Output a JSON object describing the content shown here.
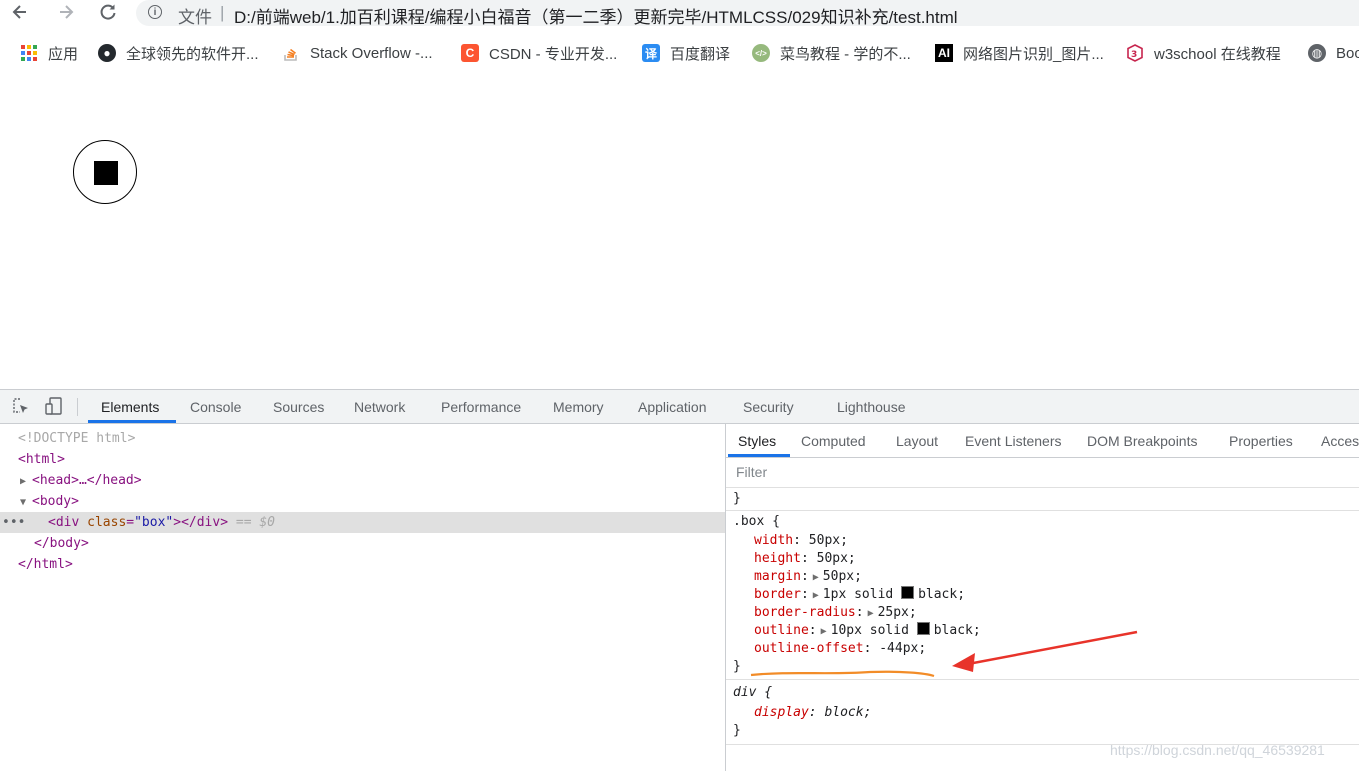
{
  "addressbar": {
    "back_icon": "arrow-left-icon",
    "forward_icon": "arrow-right-icon",
    "reload_icon": "reload-icon",
    "info_icon": "info-icon",
    "scheme_label": "文件",
    "separator": "|",
    "url": "D:/前端web/1.加百利课程/编程小白福音（第一二季）更新完毕/HTMLCSS/029知识补充/test.html"
  },
  "bookmarks": [
    {
      "label": "应用",
      "icon": "apps-grid-icon"
    },
    {
      "label": "全球领先的软件开...",
      "icon": "github-icon"
    },
    {
      "label": "Stack Overflow -...",
      "icon": "stackoverflow-icon"
    },
    {
      "label": "CSDN - 专业开发...",
      "icon": "csdn-icon"
    },
    {
      "label": "百度翻译",
      "icon": "baidu-translate-icon"
    },
    {
      "label": "菜鸟教程 - 学的不...",
      "icon": "runoob-icon"
    },
    {
      "label": "网络图片识别_图片...",
      "icon": "ai-icon"
    },
    {
      "label": "w3school 在线教程",
      "icon": "w3school-icon"
    },
    {
      "label": "Boo",
      "icon": "globe-icon"
    }
  ],
  "devtools": {
    "toolbar_icons": [
      "inspect-element-icon",
      "device-toggle-icon"
    ],
    "tabs": [
      "Elements",
      "Console",
      "Sources",
      "Network",
      "Performance",
      "Memory",
      "Application",
      "Security",
      "Lighthouse"
    ],
    "active_tab": "Elements",
    "dom": {
      "doctype": "<!DOCTYPE html>",
      "html_open": "<html>",
      "head_collapsed": "<head>…</head>",
      "body_open": "<body>",
      "div_tag": "div",
      "div_attr_name": "class",
      "div_attr_value": "\"box\"",
      "div_close": "></div>",
      "selected_marker": "== $0",
      "body_close": "</body>",
      "html_close": "</html>",
      "dots": "•••"
    },
    "styles_tabs": [
      "Styles",
      "Computed",
      "Layout",
      "Event Listeners",
      "DOM Breakpoints",
      "Properties",
      "Acces"
    ],
    "active_styles_tab": "Styles",
    "filter_placeholder": "Filter",
    "element_style_close": "}",
    "box_rule": {
      "selector": ".box {",
      "props": [
        {
          "name": "width",
          "value": "50px;"
        },
        {
          "name": "height",
          "value": "50px;"
        },
        {
          "name": "margin",
          "value": "50px;"
        },
        {
          "name": "border",
          "value": "1px solid",
          "color_name": "black;"
        },
        {
          "name": "border-radius",
          "value": "25px;"
        },
        {
          "name": "outline",
          "value": "10px solid",
          "color_name": "black;"
        },
        {
          "name": "outline-offset",
          "value": "-44px;"
        }
      ],
      "close": "}"
    },
    "div_rule": {
      "selector": "div {",
      "prop_name": "display",
      "prop_value": "block;",
      "close": "}"
    }
  },
  "annotation": {
    "arrow_color": "#e8332a",
    "underline_color": "#f28c28"
  },
  "watermark": "https://blog.csdn.net/qq_46539281",
  "colors": {
    "accent": "#1a73e8",
    "tag": "#881280",
    "attr": "#994500",
    "prop": "#c80000"
  }
}
